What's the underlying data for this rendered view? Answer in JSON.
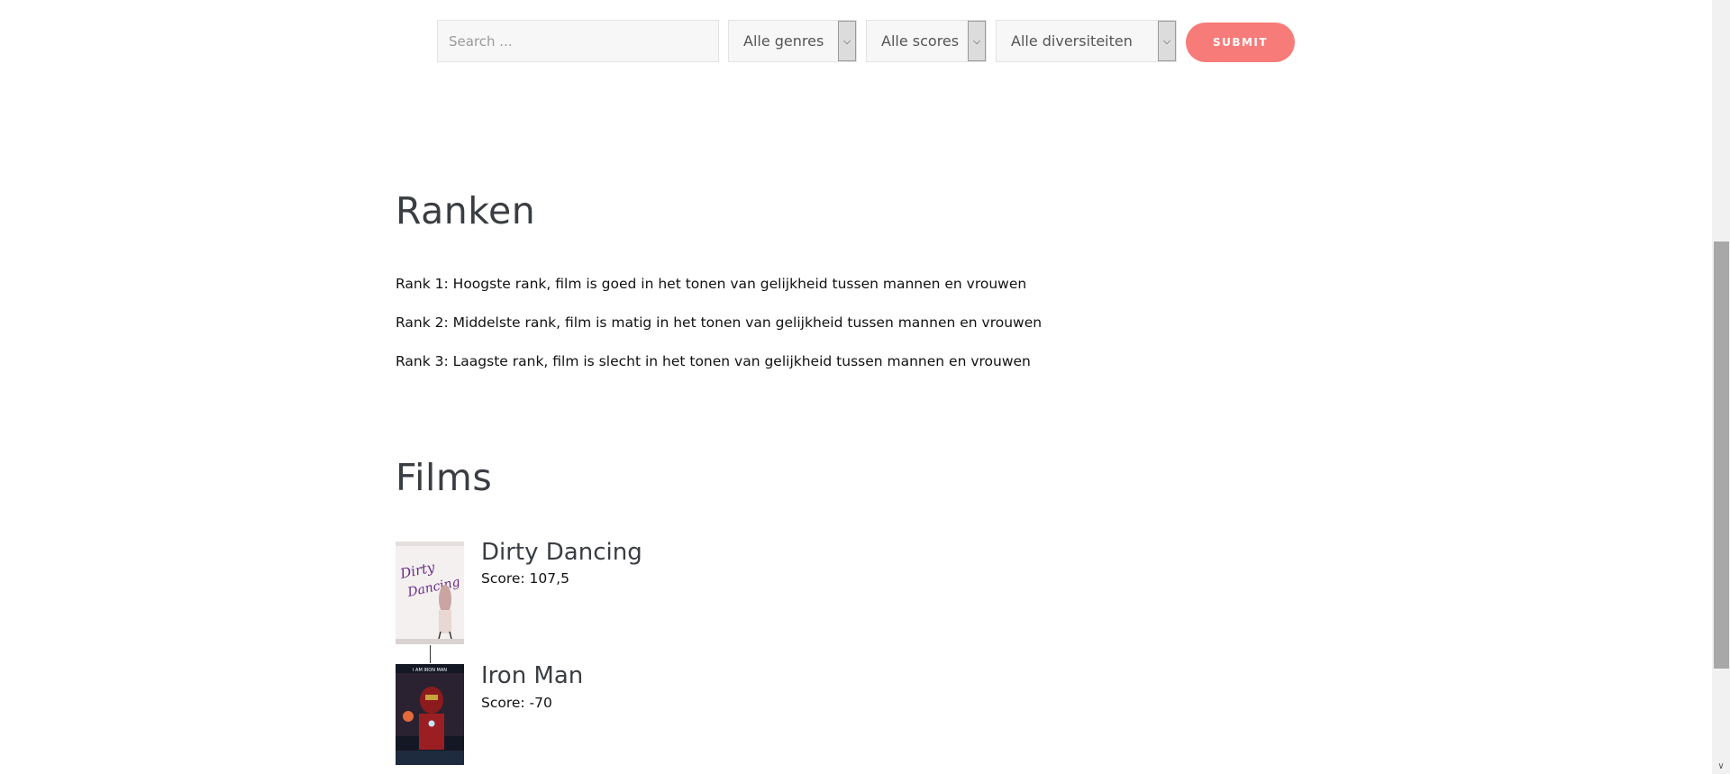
{
  "filters": {
    "search_placeholder": "Search ...",
    "genre": "Alle genres",
    "score": "Alle scores",
    "diversity": "Alle diversiteiten",
    "submit_label": "SUBMIT"
  },
  "ranks": {
    "title": "Ranken",
    "items": [
      "Rank 1: Hoogste rank, film is goed in het tonen van gelijkheid tussen mannen en vrouwen",
      "Rank 2: Middelste rank, film is matig in het tonen van gelijkheid tussen mannen en vrouwen",
      "Rank 3: Laagste rank, film is slecht in het tonen van gelijkheid tussen mannen en vrouwen"
    ]
  },
  "films": {
    "title": "Films",
    "items": [
      {
        "title": "Dirty Dancing",
        "score": "Score: 107,5",
        "poster_text": "Dirty Dancing"
      },
      {
        "title": "Iron Man",
        "score": "Score: -70",
        "poster_text": "I AM IRON MAN"
      }
    ]
  },
  "colors": {
    "accent": "#f77b78",
    "heading": "#3a3d42"
  }
}
